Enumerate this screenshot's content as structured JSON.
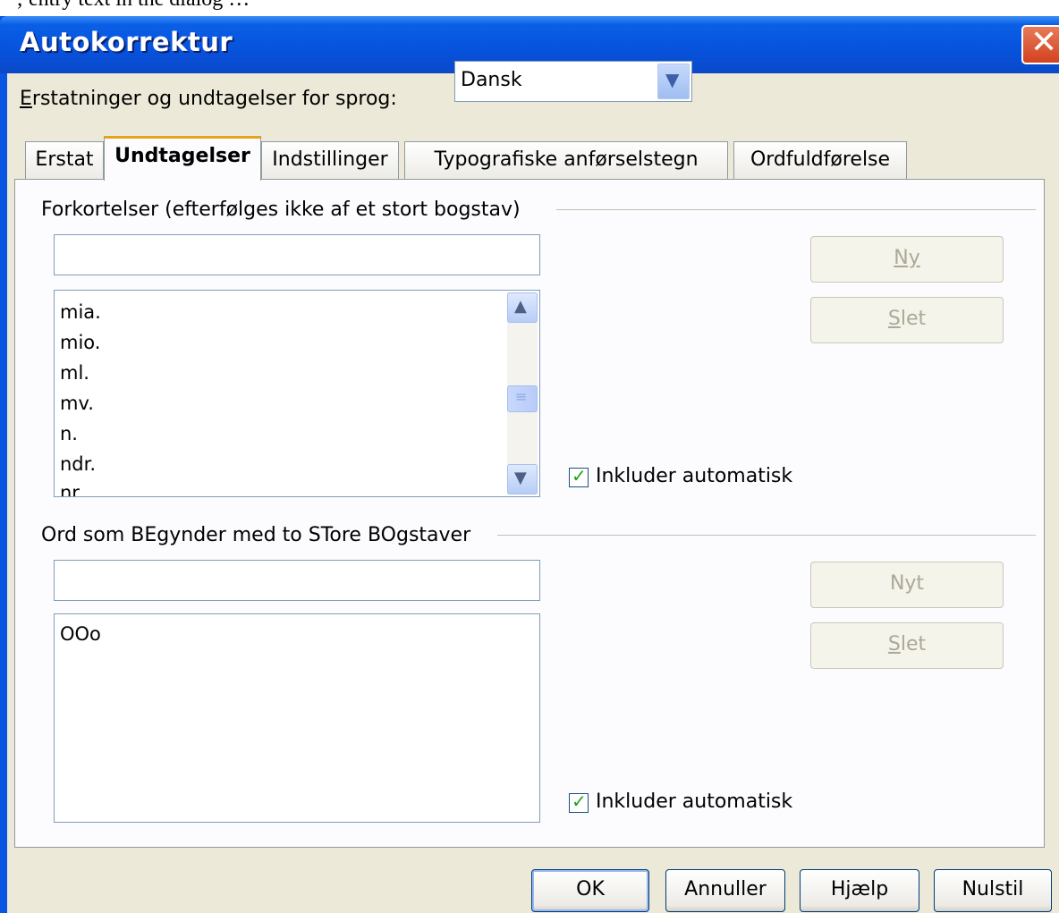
{
  "dialog": {
    "title": "Autokorrektur"
  },
  "language": {
    "label": "Erstatninger og undtagelser for sprog:",
    "value": "Dansk"
  },
  "tabs": [
    {
      "label": "Erstat",
      "active": false
    },
    {
      "label": "Undtagelser",
      "active": true
    },
    {
      "label": "Indstillinger",
      "active": false
    },
    {
      "label": "Typografiske anførselstegn",
      "active": false
    },
    {
      "label": "Ordfuldførelse",
      "active": false
    }
  ],
  "abbreviations": {
    "group_label": "Forkortelser (efterfølges ikke af et stort bogstav)",
    "input_value": "",
    "items": [
      "mia.",
      "mio.",
      "ml.",
      "mv.",
      "n.",
      "ndr.",
      "nr."
    ],
    "new_label": "Ny",
    "delete_label": "Slet",
    "auto_include_label": "Inkluder automatisk",
    "auto_include_checked": true
  },
  "double_caps": {
    "group_label": "Ord som BEgynder med to STore BOgstaver",
    "input_value": "",
    "items": [
      "OOo"
    ],
    "new_label": "Nyt",
    "delete_label": "Slet",
    "auto_include_label": "Inkluder automatisk",
    "auto_include_checked": true
  },
  "footer": {
    "ok": "OK",
    "cancel": "Annuller",
    "help": "Hjælp",
    "reset": "Nulstil"
  },
  "colors": {
    "titlebar": "#0752dc",
    "dialog_bg": "#ece9d8",
    "active_tab_accent": "#e6a21a",
    "close": "#d3421f"
  }
}
